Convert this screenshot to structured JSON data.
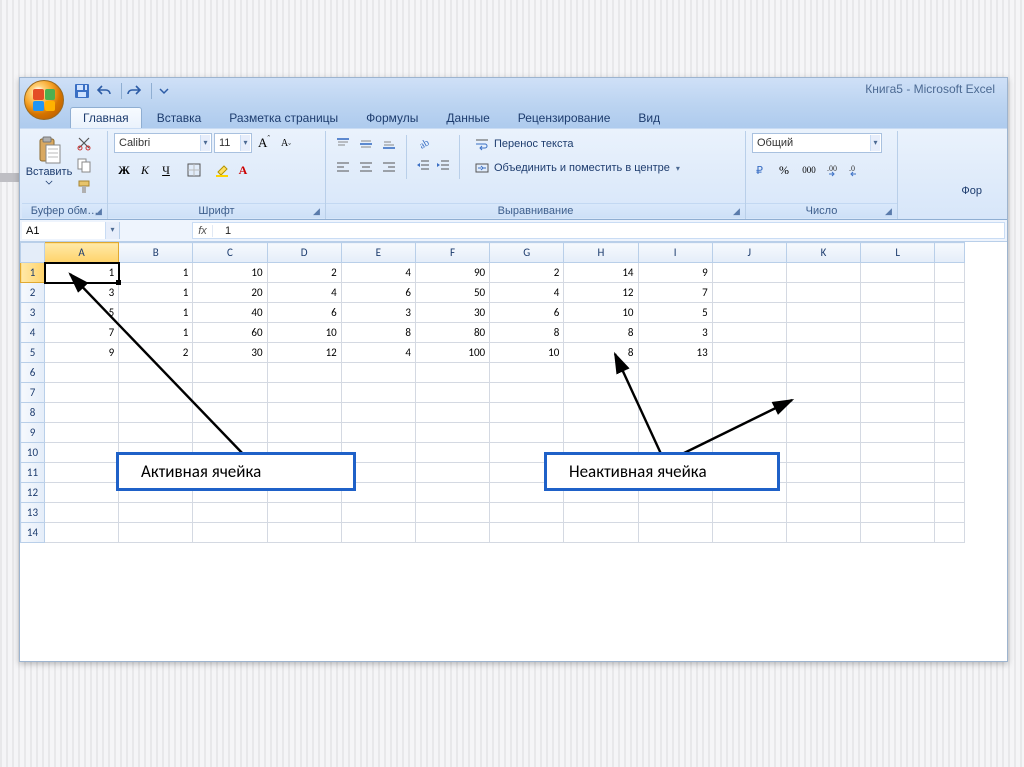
{
  "title": "Книга5 - Microsoft Excel",
  "qat": {
    "save": "save-icon",
    "undo": "undo-icon",
    "redo": "redo-icon"
  },
  "tabs": [
    {
      "label": "Главная",
      "active": true
    },
    {
      "label": "Вставка",
      "active": false
    },
    {
      "label": "Разметка страницы",
      "active": false
    },
    {
      "label": "Формулы",
      "active": false
    },
    {
      "label": "Данные",
      "active": false
    },
    {
      "label": "Рецензирование",
      "active": false
    },
    {
      "label": "Вид",
      "active": false
    }
  ],
  "ribbon": {
    "clipboard": {
      "paste": "Вставить",
      "label": "Буфер обм…"
    },
    "font": {
      "name": "Calibri",
      "size": "11",
      "bold": "Ж",
      "italic": "К",
      "underline": "Ч",
      "label": "Шрифт"
    },
    "alignment": {
      "wrap": "Перенос текста",
      "merge": "Объединить и поместить в центре",
      "label": "Выравнивание"
    },
    "number": {
      "format": "Общий",
      "percent": "%",
      "thousands": "000",
      "label": "Число"
    },
    "format_tail": "Фор"
  },
  "namebox": "A1",
  "formula": "1",
  "columns": [
    "A",
    "B",
    "C",
    "D",
    "E",
    "F",
    "G",
    "H",
    "I",
    "J",
    "K",
    "L"
  ],
  "active_col": "A",
  "active_row": 1,
  "chart_data": {
    "type": "table",
    "columns": [
      "A",
      "B",
      "C",
      "D",
      "E",
      "F",
      "G",
      "H",
      "I"
    ],
    "rows": [
      [
        1,
        1,
        10,
        2,
        4,
        90,
        2,
        14,
        9
      ],
      [
        3,
        1,
        20,
        4,
        6,
        50,
        4,
        12,
        7
      ],
      [
        5,
        1,
        40,
        6,
        3,
        30,
        6,
        10,
        5
      ],
      [
        7,
        1,
        60,
        10,
        8,
        80,
        8,
        8,
        3
      ],
      [
        9,
        2,
        30,
        12,
        4,
        100,
        10,
        8,
        13
      ]
    ]
  },
  "row_count": 14,
  "annotations": {
    "active": "Активная ячейка",
    "inactive": "Неактивная ячейка"
  }
}
